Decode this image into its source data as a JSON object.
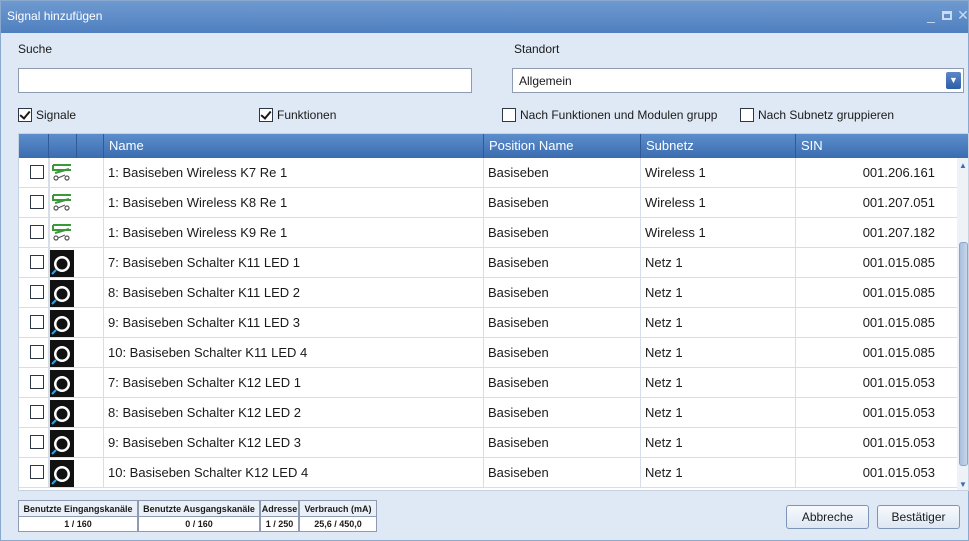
{
  "window": {
    "title": "Signal hinzufügen"
  },
  "filters": {
    "search_label": "Suche",
    "search_value": "",
    "location_label": "Standort",
    "location_value": "Allgemein",
    "signals_label": "Signale",
    "signals_checked": true,
    "functions_label": "Funktionen",
    "functions_checked": true,
    "group_functions_label": "Nach Funktionen und Modulen grupp",
    "group_functions_checked": false,
    "group_subnet_label": "Nach Subnetz gruppieren",
    "group_subnet_checked": false
  },
  "grid": {
    "columns": [
      "Name",
      "Position Name",
      "Subnetz",
      "SIN"
    ],
    "rows": [
      {
        "icon": "wireless-relay-icon",
        "name": "1: Basiseben Wireless K7 Re 1",
        "position": "Basiseben",
        "subnet": "Wireless 1",
        "sin": "001.206.161"
      },
      {
        "icon": "wireless-relay-icon",
        "name": "1: Basiseben Wireless K8 Re 1",
        "position": "Basiseben",
        "subnet": "Wireless 1",
        "sin": "001.207.051"
      },
      {
        "icon": "wireless-relay-icon",
        "name": "1: Basiseben Wireless K9 Re 1",
        "position": "Basiseben",
        "subnet": "Wireless 1",
        "sin": "001.207.182"
      },
      {
        "icon": "switch-led-icon",
        "name": "7: Basiseben Schalter K11 LED 1",
        "position": "Basiseben",
        "subnet": "Netz 1",
        "sin": "001.015.085"
      },
      {
        "icon": "switch-led-icon",
        "name": "8: Basiseben Schalter K11 LED 2",
        "position": "Basiseben",
        "subnet": "Netz 1",
        "sin": "001.015.085"
      },
      {
        "icon": "switch-led-icon",
        "name": "9: Basiseben Schalter K11 LED 3",
        "position": "Basiseben",
        "subnet": "Netz 1",
        "sin": "001.015.085"
      },
      {
        "icon": "switch-led-icon",
        "name": "10: Basiseben Schalter K11 LED 4",
        "position": "Basiseben",
        "subnet": "Netz 1",
        "sin": "001.015.085"
      },
      {
        "icon": "switch-led-icon",
        "name": "7: Basiseben Schalter K12 LED 1",
        "position": "Basiseben",
        "subnet": "Netz 1",
        "sin": "001.015.053"
      },
      {
        "icon": "switch-led-icon",
        "name": "8: Basiseben Schalter K12 LED 2",
        "position": "Basiseben",
        "subnet": "Netz 1",
        "sin": "001.015.053"
      },
      {
        "icon": "switch-led-icon",
        "name": "9: Basiseben Schalter K12 LED 3",
        "position": "Basiseben",
        "subnet": "Netz 1",
        "sin": "001.015.053"
      },
      {
        "icon": "switch-led-icon",
        "name": "10: Basiseben Schalter K12 LED 4",
        "position": "Basiseben",
        "subnet": "Netz 1",
        "sin": "001.015.053"
      }
    ]
  },
  "stats": [
    {
      "label": "Benutzte Eingangskanäle",
      "value": "1 / 160"
    },
    {
      "label": "Benutzte Ausgangskanäle",
      "value": "0 / 160"
    },
    {
      "label": "Adresse",
      "value": "1 / 250"
    },
    {
      "label": "Verbrauch (mA)",
      "value": "25,6 / 450,0"
    }
  ],
  "buttons": {
    "cancel": "Abbreche",
    "confirm": "Bestätiger"
  },
  "colors": {
    "titlebar": "#5b8ac9",
    "grid_header": "#4a7bbd",
    "background": "#dfe9f5"
  }
}
